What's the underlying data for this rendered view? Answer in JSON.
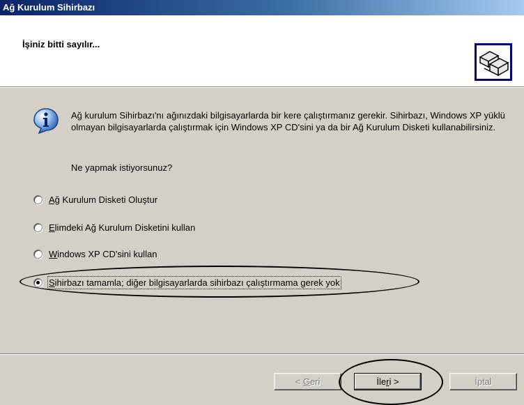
{
  "window": {
    "title": "Ağ Kurulum Sihirbazı"
  },
  "header": {
    "title": "İşiniz bitti sayılır..."
  },
  "info": {
    "text": "Ağ kurulum Sihirbazı'nı ağınızdaki bilgisayarlarda bir kere çalıştırmanız gerekir. Sihirbazı, Windows XP yüklü olmayan bilgisayarlarda çalıştırmak için Windows XP CD'sini ya da bir Ağ Kurulum Disketi kullanabilirsiniz."
  },
  "question": "Ne yapmak istiyorsunuz?",
  "options": [
    {
      "access_key": "Ağ",
      "rest": " Kurulum Disketi Oluştur",
      "selected": false
    },
    {
      "access_key": "E",
      "rest": "limdeki Ağ Kurulum Disketini kullan",
      "selected": false
    },
    {
      "access_key": "W",
      "rest": "indows XP CD'sini kullan",
      "selected": false
    },
    {
      "access_key": "S",
      "rest": "ihirbazı tamamla; diğer bilgisayarlarda sihirbazı çalıştırmama gerek yok",
      "selected": true
    }
  ],
  "buttons": {
    "back": {
      "pre": "< ",
      "key": "G",
      "post": "eri",
      "enabled": false
    },
    "next": {
      "pre": "İle",
      "key": "r",
      "post": "i >",
      "enabled": true
    },
    "cancel": {
      "label": "İptal",
      "enabled": false
    }
  },
  "colors": {
    "titlebar": "#0a246a",
    "face": "#d4d0c8"
  }
}
